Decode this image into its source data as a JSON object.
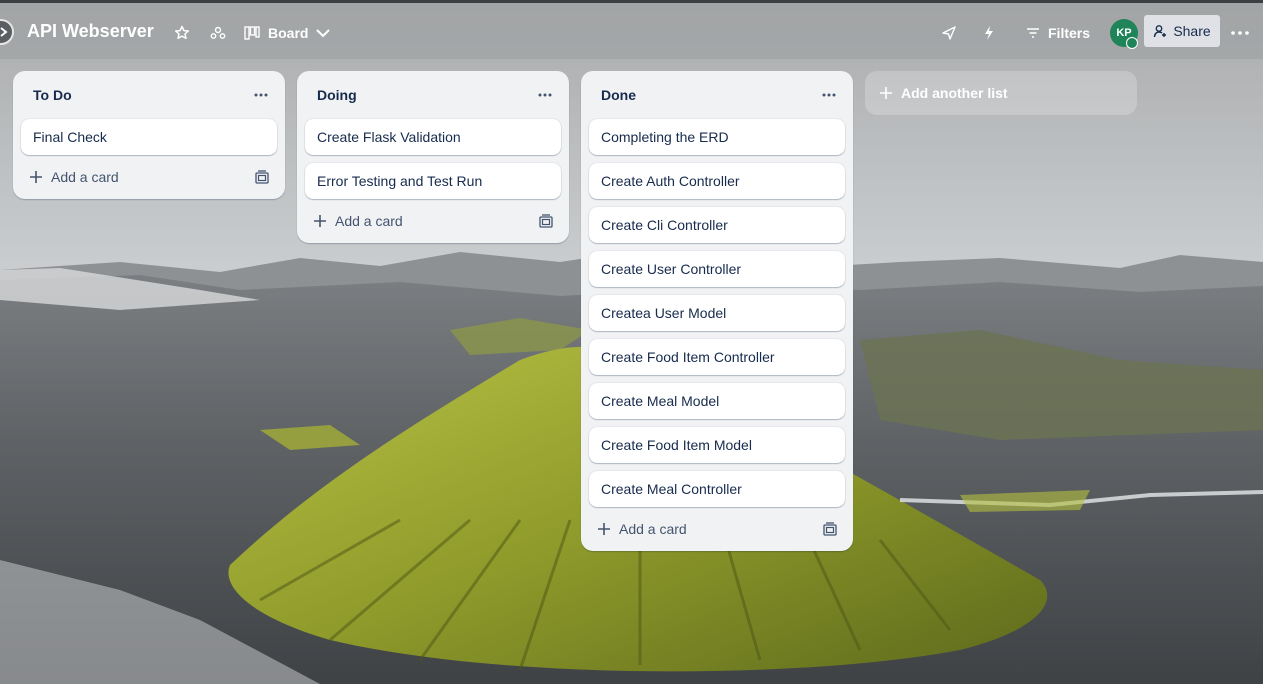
{
  "board": {
    "title": "API Webserver",
    "view_label": "Board",
    "filters_label": "Filters",
    "share_label": "Share",
    "avatar_initials": "KP",
    "colors": {
      "avatar": "#1f845a",
      "list_bg": "#f1f2f4",
      "text": "#172b4d"
    }
  },
  "lists": [
    {
      "title": "To Do",
      "cards": [
        "Final Check"
      ],
      "add_label": "Add a card"
    },
    {
      "title": "Doing",
      "cards": [
        "Create Flask Validation",
        "Error Testing and Test Run"
      ],
      "add_label": "Add a card"
    },
    {
      "title": "Done",
      "cards": [
        "Completing the ERD",
        "Create Auth Controller",
        "Create Cli Controller",
        "Create User Controller",
        "Createa User Model",
        "Create Food Item Controller",
        "Create Meal Model",
        "Create Food Item Model",
        "Create Meal Controller"
      ],
      "add_label": "Add a card"
    }
  ],
  "add_list_label": "Add another list"
}
